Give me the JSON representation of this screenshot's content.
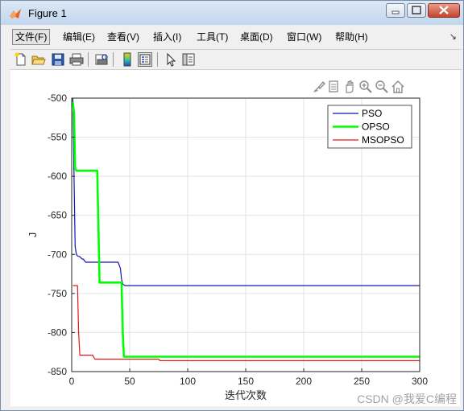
{
  "window": {
    "title": "Figure 1"
  },
  "menu": {
    "items": [
      "文件(F)",
      "编辑(E)",
      "查看(V)",
      "插入(I)",
      "工具(T)",
      "桌面(D)",
      "窗口(W)",
      "帮助(H)"
    ],
    "overflow_icon": "chevron-icon"
  },
  "toolbar": {
    "icons": [
      "new-figure-icon",
      "open-file-icon",
      "save-icon",
      "print-icon",
      "print-preview-icon",
      "colorbar-icon",
      "legend-icon",
      "pointer-icon",
      "property-editor-icon"
    ]
  },
  "axes_toolbar": {
    "icons": [
      "brush-icon",
      "data-tips-icon",
      "pan-icon",
      "zoom-in-icon",
      "zoom-out-icon",
      "home-icon"
    ]
  },
  "chart_data": {
    "type": "line",
    "xlabel": "迭代次数",
    "ylabel": "J",
    "xlim": [
      0,
      300
    ],
    "ylim": [
      -850,
      -500
    ],
    "xticks": [
      0,
      50,
      100,
      150,
      200,
      250,
      300
    ],
    "yticks": [
      -500,
      -550,
      -600,
      -650,
      -700,
      -750,
      -800,
      -850
    ],
    "grid": true,
    "legend_position": "top-right",
    "series": [
      {
        "name": "PSO",
        "color": "#1414b4",
        "width": 1.2,
        "x": [
          1,
          2,
          3,
          4,
          5,
          7,
          9,
          10,
          12,
          20,
          30,
          40,
          42,
          43,
          44,
          46,
          300
        ],
        "y": [
          -500,
          -600,
          -690,
          -700,
          -702,
          -703,
          -706,
          -706,
          -710,
          -710,
          -710,
          -710,
          -718,
          -732,
          -738,
          -740,
          -740
        ]
      },
      {
        "name": "OPSO",
        "color": "#00ff00",
        "width": 2.6,
        "x": [
          1,
          2,
          3,
          4,
          5,
          22,
          23,
          24,
          43,
          44,
          45,
          300
        ],
        "y": [
          -505,
          -520,
          -590,
          -593,
          -593,
          -593,
          -660,
          -736,
          -736,
          -800,
          -831,
          -831
        ]
      },
      {
        "name": "MSOPSO",
        "color": "#e01818",
        "width": 1.2,
        "x": [
          1,
          5,
          6,
          7,
          18,
          20,
          75,
          76,
          300
        ],
        "y": [
          -740,
          -740,
          -800,
          -829,
          -829,
          -834,
          -834,
          -836,
          -836
        ]
      }
    ]
  },
  "watermark": "CSDN @我爱C编程"
}
